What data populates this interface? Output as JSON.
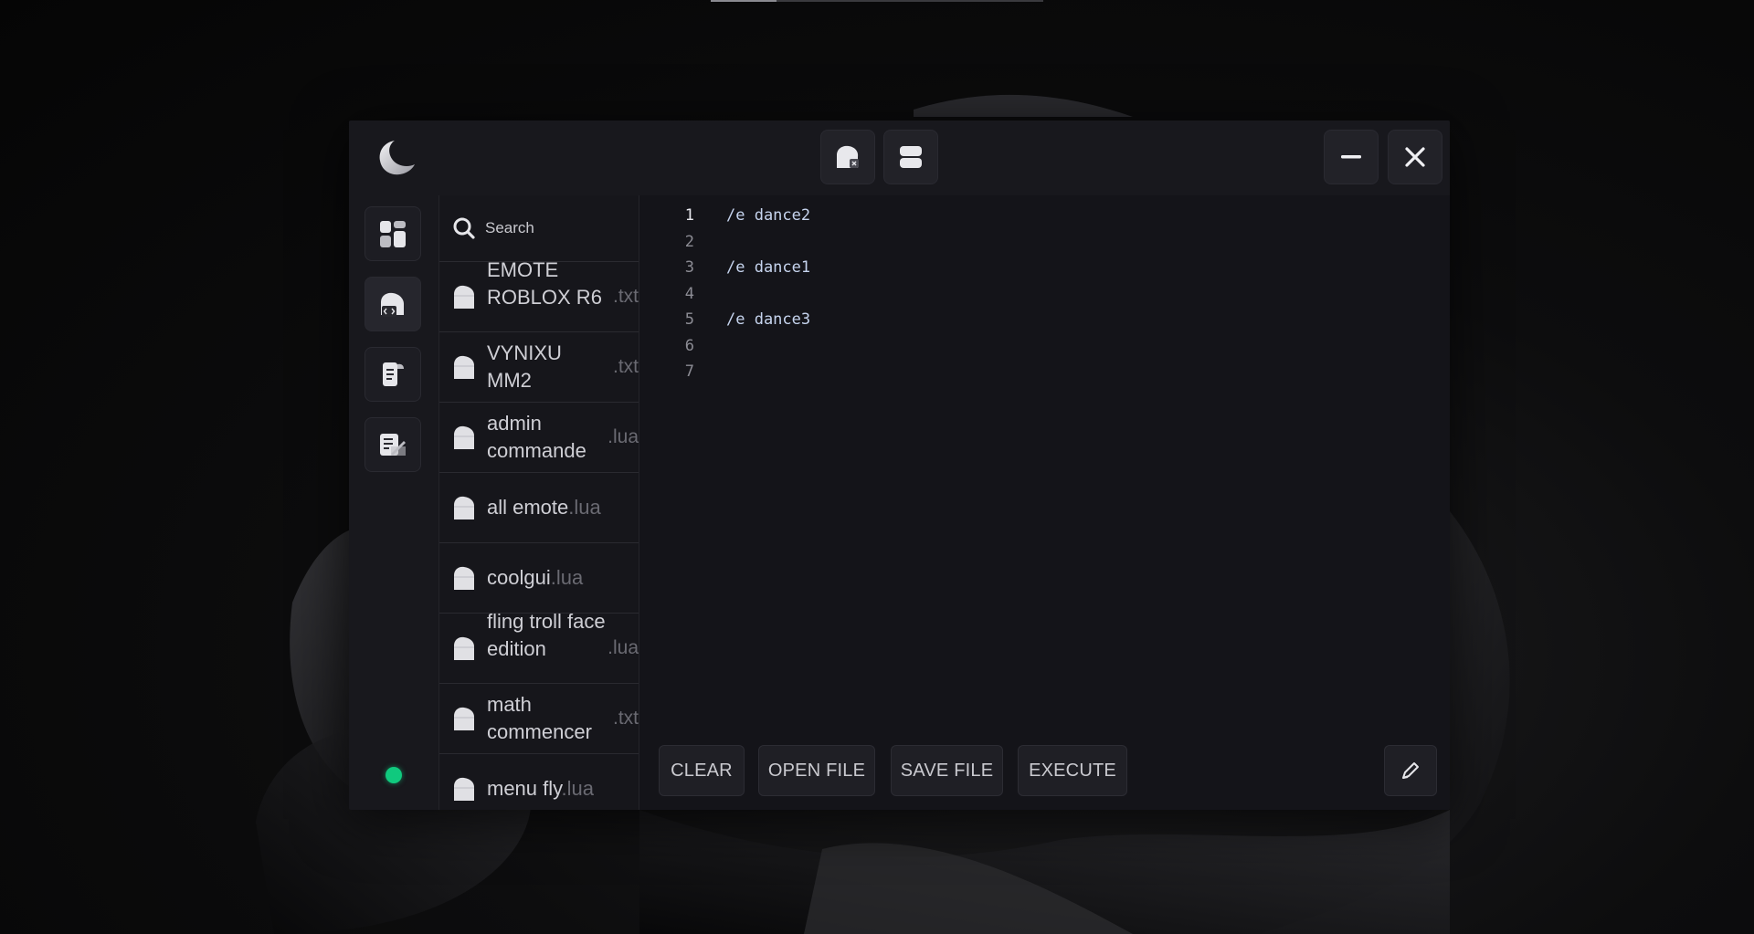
{
  "titlebar": {
    "tabs": [
      {
        "icon": "script-close-icon"
      },
      {
        "icon": "split-view-icon"
      }
    ],
    "minimize_icon": "minimize-icon",
    "close_icon": "close-icon"
  },
  "rail": {
    "items": [
      {
        "icon": "dashboard-icon"
      },
      {
        "icon": "code-file-icon"
      },
      {
        "icon": "script-scroll-icon"
      },
      {
        "icon": "settings-doc-icon"
      }
    ],
    "status_color": "#10c97e"
  },
  "search": {
    "placeholder": "Search"
  },
  "files": [
    {
      "name": "EMOTE ROBLOX R6",
      "ext": ".txt"
    },
    {
      "name": "VYNIXU MM2",
      "ext": ".txt"
    },
    {
      "name": "admin commande",
      "ext": ".lua"
    },
    {
      "name": "all emote",
      "ext": ".lua"
    },
    {
      "name": "coolgui",
      "ext": ".lua"
    },
    {
      "name": "fling troll face edition",
      "ext": ".lua"
    },
    {
      "name": "math commencer",
      "ext": ".txt"
    },
    {
      "name": "menu fly",
      "ext": ".lua"
    }
  ],
  "editor": {
    "line_numbers": [
      "1",
      "2",
      "3",
      "4",
      "5",
      "6",
      "7"
    ],
    "lines": [
      "/e dance2",
      "",
      "/e dance1",
      "",
      "/e dance3",
      "",
      ""
    ]
  },
  "actions": {
    "clear": "CLEAR",
    "open": "OPEN FILE",
    "save": "SAVE FILE",
    "execute": "EXECUTE"
  },
  "colors": {
    "accent_green": "#10c97e",
    "background": "#141419"
  }
}
